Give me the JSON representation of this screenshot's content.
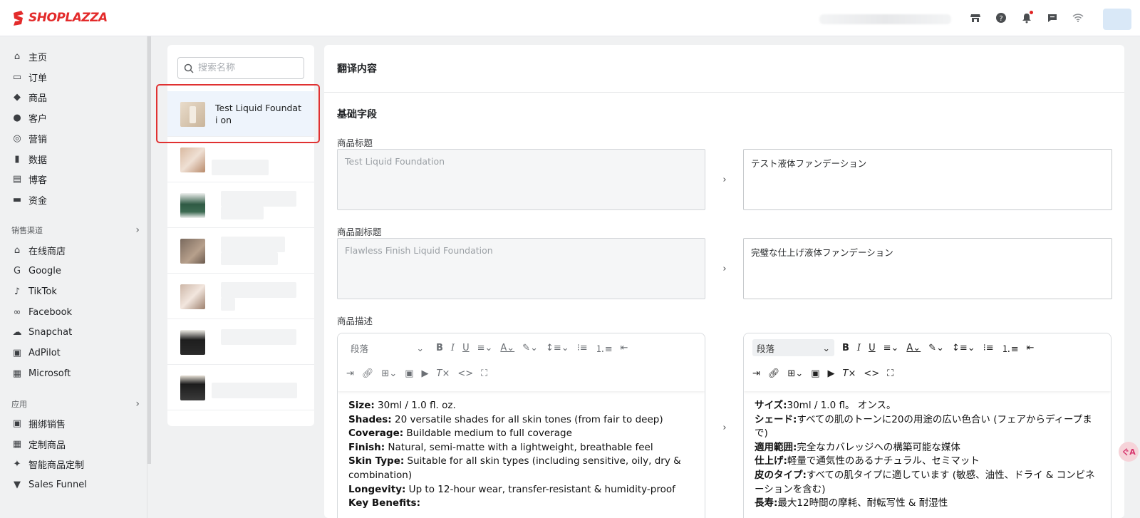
{
  "brand": {
    "name": "SHOPLAZZA",
    "color": "#e32b2b"
  },
  "topbar": {
    "icons": [
      "store-icon",
      "help-icon",
      "bell-icon",
      "message-icon",
      "wifi-icon"
    ]
  },
  "sidebar": {
    "items": [
      {
        "label": "主页",
        "icon": "home-icon"
      },
      {
        "label": "订单",
        "icon": "inbox-icon"
      },
      {
        "label": "商品",
        "icon": "tag-icon"
      },
      {
        "label": "客户",
        "icon": "person-icon"
      },
      {
        "label": "营销",
        "icon": "target-icon"
      },
      {
        "label": "数据",
        "icon": "bar-chart-icon"
      },
      {
        "label": "博客",
        "icon": "blog-icon"
      },
      {
        "label": "资金",
        "icon": "finance-icon"
      }
    ],
    "channels_title": "销售渠道",
    "channels": [
      {
        "label": "在线商店",
        "icon": "store-icon"
      },
      {
        "label": "Google",
        "icon": "google-icon"
      },
      {
        "label": "TikTok",
        "icon": "tiktok-icon"
      },
      {
        "label": "Facebook",
        "icon": "meta-icon"
      },
      {
        "label": "Snapchat",
        "icon": "snapchat-icon"
      },
      {
        "label": "AdPilot",
        "icon": "adpilot-icon"
      },
      {
        "label": "Microsoft",
        "icon": "microsoft-icon"
      }
    ],
    "apps_title": "应用",
    "apps": [
      {
        "label": "捆绑销售",
        "icon": "bundle-icon"
      },
      {
        "label": "定制商品",
        "icon": "custom-icon"
      },
      {
        "label": "智能商品定制",
        "icon": "smart-custom-icon"
      },
      {
        "label": "Sales Funnel",
        "icon": "funnel-icon"
      }
    ]
  },
  "list": {
    "search_placeholder": "搜索名称",
    "items": [
      {
        "name": "Test Liquid Foundati on",
        "active": true
      }
    ]
  },
  "main": {
    "header": "翻译内容",
    "section": "基础字段",
    "fields": {
      "title_label": "商品标题",
      "title_src": "Test Liquid Foundation",
      "title_dst": "テスト液体ファンデーション",
      "subtitle_label": "商品副标题",
      "subtitle_src": "Flawless Finish Liquid Foundation",
      "subtitle_dst": "完璧な仕上げ液体ファンデーション",
      "desc_label": "商品描述"
    },
    "editor_para": "段落",
    "src_desc": [
      {
        "k": "Size:",
        "v": " 30ml / 1.0 fl. oz."
      },
      {
        "k": "Shades:",
        "v": " 20 versatile shades for all skin tones (from fair to deep)"
      },
      {
        "k": "Coverage:",
        "v": " Buildable medium to full coverage"
      },
      {
        "k": "Finish:",
        "v": " Natural, semi-matte with a lightweight, breathable feel"
      },
      {
        "k": "Skin Type:",
        "v": " Suitable for all skin types (including sensitive, oily, dry & combination)"
      },
      {
        "k": "Longevity:",
        "v": " Up to 12-hour wear, transfer-resistant & humidity-proof"
      },
      {
        "k": "Key Benefits:",
        "v": ""
      }
    ],
    "dst_desc": [
      {
        "k": "サイズ:",
        "v": "30ml / 1.0 fl。 オンス。"
      },
      {
        "k": "シェード:",
        "v": "すべての肌のトーンに20の用途の広い色合い (フェアからディープまで)"
      },
      {
        "k": "適用範囲:",
        "v": "完全なカバレッジへの構築可能な媒体"
      },
      {
        "k": "仕上げ:",
        "v": "軽量で通気性のあるナチュラル、セミマット"
      },
      {
        "k": "皮のタイプ:",
        "v": "すべての肌タイプに適しています (敏感、油性、ドライ & コンビネーションを含む)"
      },
      {
        "k": "長寿:",
        "v": "最大12時間の摩耗、耐転写性 & 耐湿性"
      }
    ]
  },
  "fab_label": "ぐA"
}
